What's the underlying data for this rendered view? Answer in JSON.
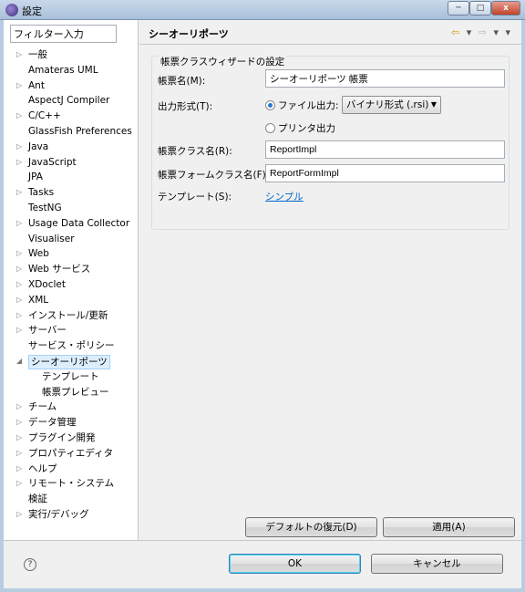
{
  "window": {
    "title": "設定",
    "minimize_glyph": "─",
    "maximize_glyph": "□",
    "close_glyph": "x"
  },
  "sidebar": {
    "filter_value": "フィルター入力",
    "items": [
      {
        "label": "一般",
        "expander": "▷"
      },
      {
        "label": "Amateras UML",
        "expander": ""
      },
      {
        "label": "Ant",
        "expander": "▷"
      },
      {
        "label": "AspectJ Compiler",
        "expander": ""
      },
      {
        "label": "C/C++",
        "expander": "▷"
      },
      {
        "label": "GlassFish Preferences",
        "expander": ""
      },
      {
        "label": "Java",
        "expander": "▷"
      },
      {
        "label": "JavaScript",
        "expander": "▷"
      },
      {
        "label": "JPA",
        "expander": ""
      },
      {
        "label": "Tasks",
        "expander": "▷"
      },
      {
        "label": "TestNG",
        "expander": ""
      },
      {
        "label": "Usage Data Collector",
        "expander": "▷"
      },
      {
        "label": "Visualiser",
        "expander": ""
      },
      {
        "label": "Web",
        "expander": "▷"
      },
      {
        "label": "Web サービス",
        "expander": "▷"
      },
      {
        "label": "XDoclet",
        "expander": "▷"
      },
      {
        "label": "XML",
        "expander": "▷"
      },
      {
        "label": "インストール/更新",
        "expander": "▷"
      },
      {
        "label": "サーバー",
        "expander": "▷"
      },
      {
        "label": "サービス・ポリシー",
        "expander": ""
      },
      {
        "label": "シーオーリポーツ",
        "expander": "◢",
        "selected": true
      },
      {
        "label": "テンプレート",
        "expander": "",
        "child": true
      },
      {
        "label": "帳票プレビュー",
        "expander": "",
        "child": true
      },
      {
        "label": "チーム",
        "expander": "▷"
      },
      {
        "label": "データ管理",
        "expander": "▷"
      },
      {
        "label": "プラグイン開発",
        "expander": "▷"
      },
      {
        "label": "プロパティエディタ",
        "expander": "▷"
      },
      {
        "label": "ヘルプ",
        "expander": "▷"
      },
      {
        "label": "リモート・システム",
        "expander": "▷"
      },
      {
        "label": "検証",
        "expander": ""
      },
      {
        "label": "実行/デバッグ",
        "expander": "▷"
      }
    ]
  },
  "page": {
    "title": "シーオーリポーツ",
    "nav": {
      "back": "⇦",
      "back_menu": "▾",
      "forward": "⇨",
      "forward_menu": "▾",
      "view_menu": "▾"
    },
    "group_title": "帳票クラスウィザードの設定",
    "report_name_label": "帳票名(M):",
    "report_name_value": "シーオーリポーツ 帳票",
    "output_format_label": "出力形式(T):",
    "file_output_label": "ファイル出力:",
    "format_select_value": "バイナリ形式 (.rsi)",
    "printer_output_label": "プリンタ出力",
    "class_name_label": "帳票クラス名(R):",
    "class_name_value": "ReportImpl",
    "form_class_label": "帳票フォームクラス名(F):",
    "form_class_value": "ReportFormImpl",
    "template_label": "テンプレート(S):",
    "template_link": "シンプル",
    "restore_defaults": "デフォルトの復元(D)",
    "apply": "適用(A)"
  },
  "footer": {
    "help_glyph": "?",
    "ok": "OK",
    "cancel": "キャンセル"
  }
}
